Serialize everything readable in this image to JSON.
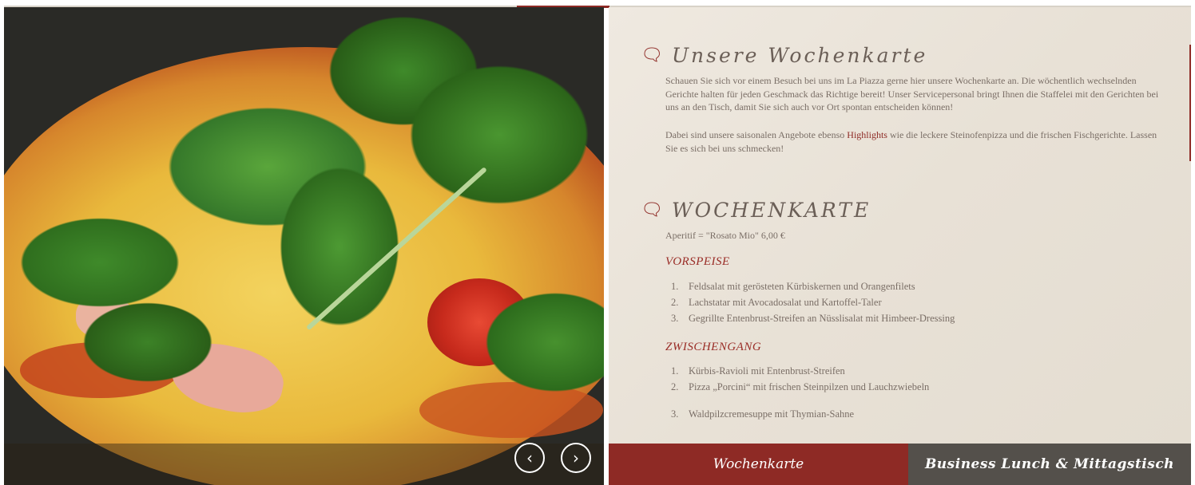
{
  "slider": {
    "prev_label": "‹",
    "next_label": "›"
  },
  "intro": {
    "icon": "speech-bubble-icon",
    "title": "Unsere Wochenkarte",
    "paragraph1": "Schauen Sie sich vor einem Besuch bei uns im La Piazza gerne hier unsere Wochenkarte an. Die wöchentlich wechselnden Gerichte halten für jeden Geschmack das Richtige bereit! Unser Servicepersonal bringt Ihnen die Staffelei mit den Gerichten bei uns an den Tisch, damit Sie sich auch vor Ort spontan entscheiden können!",
    "paragraph2_before": "Dabei sind unsere saisonalen Angebote ebenso ",
    "paragraph2_link": "Highlights",
    "paragraph2_after": " wie die leckere Steinofenpizza und die frischen Fischgerichte. Lassen Sie es sich bei uns schmecken!"
  },
  "menu": {
    "title": "WOCHENKARTE",
    "aperitif": "Aperitif = \"Rosato Mio\"  6,00 €",
    "vorspeise": {
      "label": "VORSPEISE",
      "items": [
        {
          "num": "1.",
          "text": "Feldsalat mit gerösteten Kürbiskernen und Orangenfilets"
        },
        {
          "num": "2.",
          "text": "Lachstatar mit Avocadosalat und Kartoffel-Taler"
        },
        {
          "num": "3.",
          "text": "Gegrillte Entenbrust-Streifen an Nüsslisalat mit Himbeer-Dressing"
        }
      ]
    },
    "zwischengang": {
      "label": "ZWISCHENGANG",
      "items": [
        {
          "num": "1.",
          "text": "Kürbis-Ravioli mit Entenbrust-Streifen"
        },
        {
          "num": "2.",
          "text": "Pizza „Porcini“ mit frischen Steinpilzen und Lauchzwiebeln"
        },
        {
          "num": "3.",
          "text": "Waldpilzcremesuppe mit Thymian-Sahne"
        }
      ]
    }
  },
  "tabs": {
    "active": "Wochenkarte",
    "inactive": "Business Lunch & Mittagstisch"
  },
  "colors": {
    "accent": "#8e2a25",
    "text": "#7a6e66",
    "panel": "#e8e1d6",
    "tab_inactive": "#54504b"
  }
}
